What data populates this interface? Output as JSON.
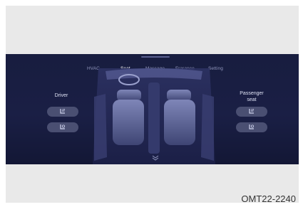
{
  "tabs": [
    {
      "label": "HVAC",
      "active": false
    },
    {
      "label": "Seat",
      "active": true
    },
    {
      "label": "Massage",
      "active": false
    },
    {
      "label": "Frarance",
      "active": false
    },
    {
      "label": "Setting",
      "active": false
    }
  ],
  "driver": {
    "label": "Driver"
  },
  "passenger": {
    "label_line1": "Passenger",
    "label_line2": "seat"
  },
  "icons": {
    "driver_top": "seat-heating-icon",
    "driver_bottom": "seat-ventilation-icon",
    "passenger_top": "seat-heating-icon",
    "passenger_bottom": "seat-ventilation-icon",
    "collapse": "chevron-down-icon"
  },
  "colors": {
    "screen_bg": "#1a1f45",
    "tab_active": "#ffffff",
    "tab_inactive": "#8f95bb",
    "button_bg": "#4a4f72"
  },
  "caption": "OMT22-2240"
}
